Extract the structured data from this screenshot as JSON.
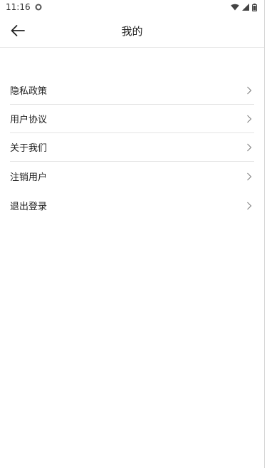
{
  "status_bar": {
    "time": "11:16"
  },
  "header": {
    "title": "我的"
  },
  "menu": {
    "items": [
      {
        "label": "隐私政策"
      },
      {
        "label": "用户协议"
      },
      {
        "label": "关于我们"
      },
      {
        "label": "注销用户"
      },
      {
        "label": "退出登录"
      }
    ]
  },
  "icons": {
    "back": "arrow-left-icon",
    "chevron": "chevron-right-icon",
    "wifi": "wifi-icon",
    "signal": "signal-icon",
    "battery": "battery-icon",
    "shield": "shield-icon"
  }
}
